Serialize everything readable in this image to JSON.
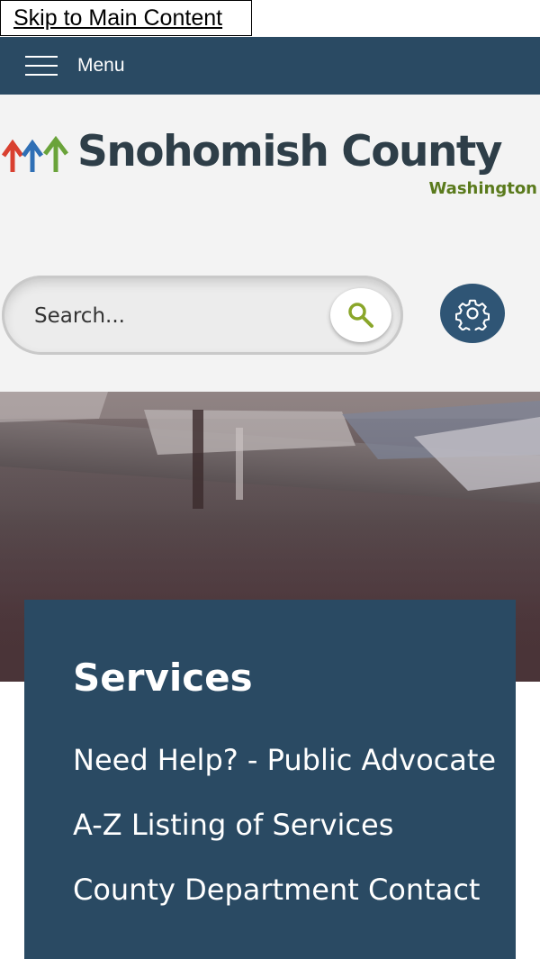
{
  "skip_link": "Skip to Main Content",
  "menu": {
    "label": "Menu"
  },
  "logo": {
    "name": "Snohomish County",
    "state": "Washington"
  },
  "search": {
    "placeholder": "Search..."
  },
  "services": {
    "title": "Services",
    "links": [
      "Need Help? - Public Advocate",
      "A-Z Listing of Services",
      "County Department Contact"
    ]
  },
  "colors": {
    "nav": "#2a4a63",
    "header_bg": "#f3f3f3",
    "accent_green": "#7a9a1e",
    "logo_text": "#2e3e48",
    "settings_btn": "#2f5575"
  },
  "icons": [
    "hamburger-icon",
    "search-icon",
    "gear-icon",
    "logo-trees-icon"
  ]
}
